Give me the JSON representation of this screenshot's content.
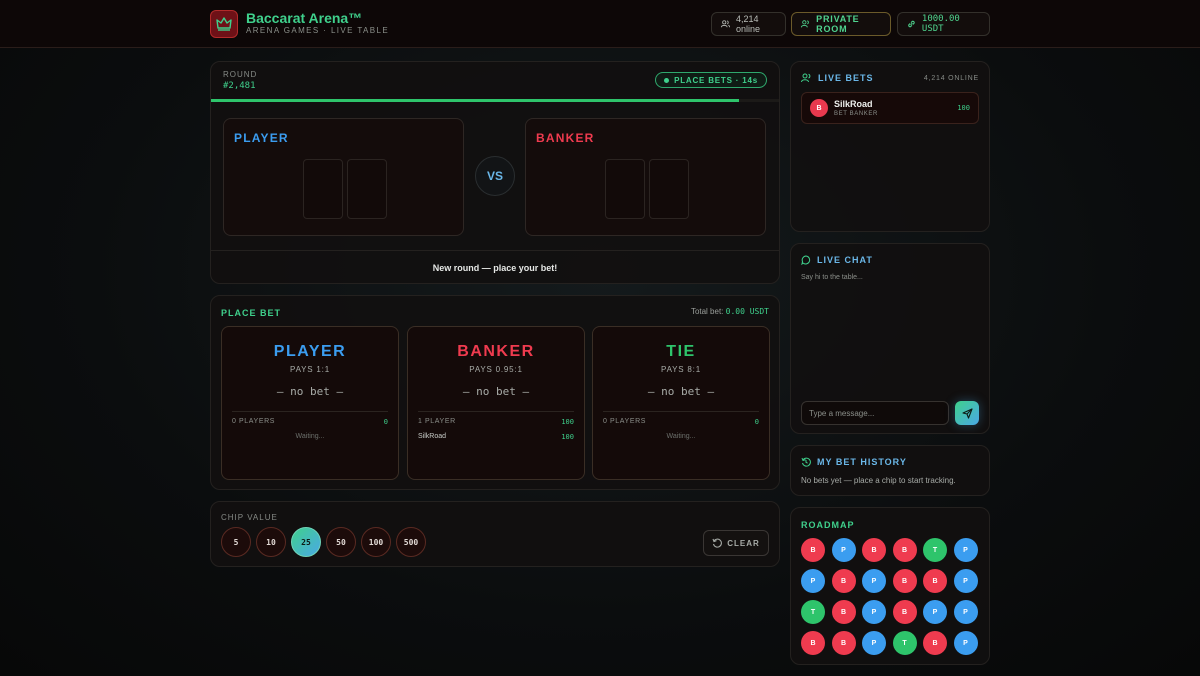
{
  "header": {
    "brand_title": "Baccarat Arena™",
    "brand_subtitle": "ARENA GAMES · LIVE TABLE",
    "online": "4,214 online",
    "private_room": "PRIVATE ROOM",
    "balance": "1000.00 USDT"
  },
  "round": {
    "label": "ROUND",
    "number": "#2,481",
    "status": "PLACE BETS · 14s",
    "progress": 0.93,
    "player_label": "PLAYER",
    "banker_label": "BANKER",
    "vs": "VS",
    "message": "New round — place your bet!"
  },
  "bets": {
    "title": "PLACE BET",
    "total_label": "Total bet:",
    "total_value": "0.00 USDT",
    "options": [
      {
        "name": "PLAYER",
        "pays": "PAYS 1:1",
        "amount": "— no bet —",
        "players": "0 PLAYERS",
        "total": "0",
        "waiting": "Waiting...",
        "color": "#3b9df0",
        "rows": []
      },
      {
        "name": "BANKER",
        "pays": "PAYS 0.95:1",
        "amount": "— no bet —",
        "players": "1 PLAYER",
        "total": "100",
        "waiting": "",
        "color": "#ef3b4f",
        "rows": [
          {
            "name": "SilkRoad",
            "amount": "100"
          }
        ]
      },
      {
        "name": "TIE",
        "pays": "PAYS 8:1",
        "amount": "— no bet —",
        "players": "0 PLAYERS",
        "total": "0",
        "waiting": "Waiting...",
        "color": "#2ec46b",
        "rows": []
      }
    ]
  },
  "chips": {
    "label": "CHIP VALUE",
    "values": [
      "5",
      "10",
      "25",
      "50",
      "100",
      "500"
    ],
    "selected": "25",
    "clear_label": "CLEAR"
  },
  "live_bets": {
    "title": "LIVE BETS",
    "online": "4,214 ONLINE",
    "items": [
      {
        "avatar": "B",
        "name": "SilkRoad",
        "sub": "BET BANKER",
        "amount": "100"
      }
    ]
  },
  "live_chat": {
    "title": "LIVE CHAT",
    "hint": "Say hi to the table...",
    "placeholder": "Type a message..."
  },
  "history": {
    "title": "MY BET HISTORY",
    "empty": "No bets yet — place a chip to start tracking."
  },
  "roadmap": {
    "title": "ROADMAP",
    "rows": [
      [
        "B",
        "P",
        "B",
        "B",
        "T",
        "P"
      ],
      [
        "P",
        "B",
        "P",
        "B",
        "B",
        "P"
      ],
      [
        "T",
        "B",
        "P",
        "B",
        "P",
        "P"
      ],
      [
        "B",
        "B",
        "P",
        "T",
        "B",
        "P"
      ]
    ]
  },
  "colors": {
    "player": "#3b9df0",
    "banker": "#ef3b4f",
    "tie": "#2ec46b",
    "accent": "#3fd08c"
  }
}
